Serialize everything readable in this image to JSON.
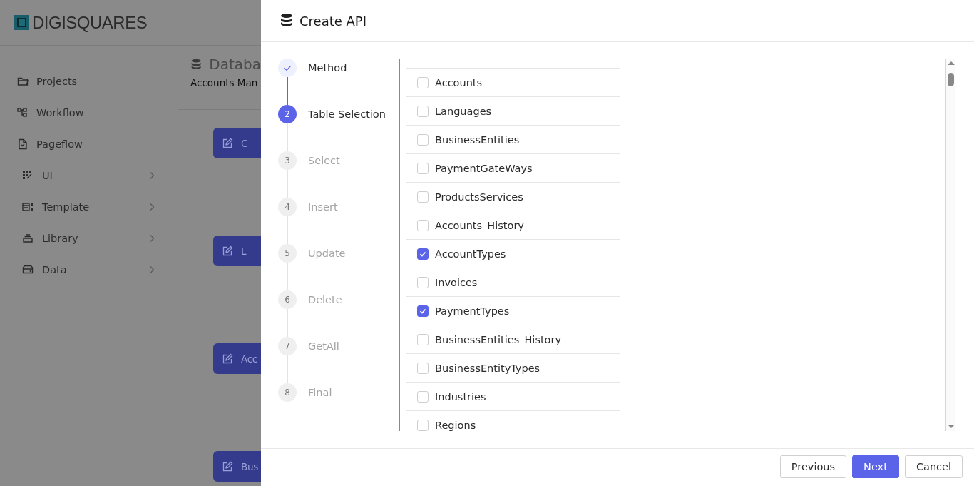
{
  "app": {
    "logo": "DIGISQUARES",
    "sidebar": {
      "items": [
        {
          "label": "Projects",
          "submenu": false
        },
        {
          "label": "Workflow",
          "submenu": false
        },
        {
          "label": "Pageflow",
          "submenu": false
        },
        {
          "label": "UI",
          "submenu": true
        },
        {
          "label": "Template",
          "submenu": true
        },
        {
          "label": "Library",
          "submenu": true
        },
        {
          "label": "Data",
          "submenu": true
        }
      ]
    },
    "page": {
      "title": "Databa",
      "subtitle": "Accounts Man",
      "buttons": [
        "C",
        "L",
        "Acc",
        "Bus"
      ]
    }
  },
  "dialog": {
    "title": "Create API",
    "steps": [
      {
        "label": "Method",
        "completed": true,
        "selected": false
      },
      {
        "number": "2",
        "label": "Table Selection",
        "completed": false,
        "selected": true
      },
      {
        "number": "3",
        "label": "Select",
        "completed": false,
        "selected": false
      },
      {
        "number": "4",
        "label": "Insert",
        "completed": false,
        "selected": false
      },
      {
        "number": "5",
        "label": "Update",
        "completed": false,
        "selected": false
      },
      {
        "number": "6",
        "label": "Delete",
        "completed": false,
        "selected": false
      },
      {
        "number": "7",
        "label": "GetAll",
        "completed": false,
        "selected": false
      },
      {
        "number": "8",
        "label": "Final",
        "completed": false,
        "selected": false
      }
    ],
    "tables": [
      {
        "name": "Accounts",
        "checked": false
      },
      {
        "name": "Languages",
        "checked": false
      },
      {
        "name": "BusinessEntities",
        "checked": false
      },
      {
        "name": "PaymentGateWays",
        "checked": false
      },
      {
        "name": "ProductsServices",
        "checked": false
      },
      {
        "name": "Accounts_History",
        "checked": false
      },
      {
        "name": "AccountTypes",
        "checked": true
      },
      {
        "name": "Invoices",
        "checked": false
      },
      {
        "name": "PaymentTypes",
        "checked": true
      },
      {
        "name": "BusinessEntities_History",
        "checked": false
      },
      {
        "name": "BusinessEntityTypes",
        "checked": false
      },
      {
        "name": "Industries",
        "checked": false
      },
      {
        "name": "Regions",
        "checked": false
      }
    ],
    "buttons": [
      {
        "label": "Previous",
        "kind": "secondary"
      },
      {
        "label": "Next",
        "kind": "primary"
      },
      {
        "label": "Cancel",
        "kind": "secondary"
      }
    ]
  }
}
